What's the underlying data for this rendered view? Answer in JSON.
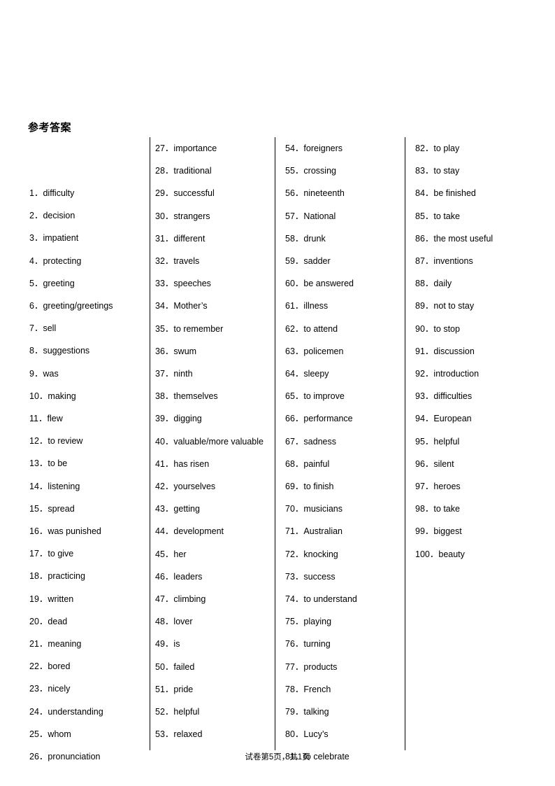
{
  "document": {
    "title": "参考答案",
    "page_size": "A4"
  },
  "columns": [
    {
      "id": "column-1",
      "items": [
        {
          "number": "1",
          "separator": "．",
          "answer": "difficulty"
        },
        {
          "number": "2",
          "separator": "．",
          "answer": "decision"
        },
        {
          "number": "3",
          "separator": "．",
          "answer": "impatient"
        },
        {
          "number": "4",
          "separator": "．",
          "answer": "protecting"
        },
        {
          "number": "5",
          "separator": "．",
          "answer": "greeting"
        },
        {
          "number": "6",
          "separator": "．",
          "answer": "greeting/greetings"
        },
        {
          "number": "7",
          "separator": "．",
          "answer": "sell"
        },
        {
          "number": "8",
          "separator": "．",
          "answer": "suggestions"
        },
        {
          "number": "9",
          "separator": "．",
          "answer": "was"
        },
        {
          "number": "10",
          "separator": "．",
          "answer": "making"
        },
        {
          "number": "11",
          "separator": "．",
          "answer": "flew"
        },
        {
          "number": "12",
          "separator": "．",
          "answer": "to review"
        },
        {
          "number": "13",
          "separator": "．",
          "answer": "to be"
        },
        {
          "number": "14",
          "separator": "．",
          "answer": "listening"
        },
        {
          "number": "15",
          "separator": "．",
          "answer": "spread"
        },
        {
          "number": "16",
          "separator": "．",
          "answer": "was punished"
        },
        {
          "number": "17",
          "separator": "．",
          "answer": "to give"
        },
        {
          "number": "18",
          "separator": "．",
          "answer": "practicing"
        },
        {
          "number": "19",
          "separator": "．",
          "answer": "written"
        },
        {
          "number": "20",
          "separator": "．",
          "answer": "dead"
        },
        {
          "number": "21",
          "separator": "．",
          "answer": "meaning"
        },
        {
          "number": "22",
          "separator": "．",
          "answer": "bored"
        },
        {
          "number": "23",
          "separator": "．",
          "answer": "nicely"
        },
        {
          "number": "24",
          "separator": "．",
          "answer": "understanding"
        },
        {
          "number": "25",
          "separator": "．",
          "answer": "whom"
        },
        {
          "number": "26",
          "separator": "．",
          "answer": "pronunciation"
        }
      ]
    },
    {
      "id": "column-2",
      "items": [
        {
          "number": "27",
          "separator": "．",
          "answer": "importance"
        },
        {
          "number": "28",
          "separator": "．",
          "answer": "traditional"
        },
        {
          "number": "29",
          "separator": "．",
          "answer": "successful"
        },
        {
          "number": "30",
          "separator": "．",
          "answer": "strangers"
        },
        {
          "number": "31",
          "separator": "．",
          "answer": "different"
        },
        {
          "number": "32",
          "separator": "．",
          "answer": "travels"
        },
        {
          "number": "33",
          "separator": "．",
          "answer": "speeches"
        },
        {
          "number": "34",
          "separator": "．",
          "answer": "Mother’s"
        },
        {
          "number": "35",
          "separator": "．",
          "answer": "to remember"
        },
        {
          "number": "36",
          "separator": "．",
          "answer": "swum"
        },
        {
          "number": "37",
          "separator": "．",
          "answer": "ninth"
        },
        {
          "number": "38",
          "separator": "．",
          "answer": "themselves"
        },
        {
          "number": "39",
          "separator": "．",
          "answer": "digging"
        },
        {
          "number": "40",
          "separator": "．",
          "answer": "valuable/more valuable"
        },
        {
          "number": "41",
          "separator": "．",
          "answer": "has risen"
        },
        {
          "number": "42",
          "separator": "．",
          "answer": "yourselves"
        },
        {
          "number": "43",
          "separator": "．",
          "answer": "getting"
        },
        {
          "number": "44",
          "separator": "．",
          "answer": "development"
        },
        {
          "number": "45",
          "separator": "．",
          "answer": "her"
        },
        {
          "number": "46",
          "separator": "．",
          "answer": "leaders"
        },
        {
          "number": "47",
          "separator": "．",
          "answer": "climbing"
        },
        {
          "number": "48",
          "separator": "．",
          "answer": "lover"
        },
        {
          "number": "49",
          "separator": "．",
          "answer": "is"
        },
        {
          "number": "50",
          "separator": "．",
          "answer": "failed"
        },
        {
          "number": "51",
          "separator": "．",
          "answer": "pride"
        },
        {
          "number": "52",
          "separator": "．",
          "answer": "helpful"
        },
        {
          "number": "53",
          "separator": "．",
          "answer": "relaxed"
        }
      ]
    },
    {
      "id": "column-3",
      "items": [
        {
          "number": "54",
          "separator": "．",
          "answer": "foreigners"
        },
        {
          "number": "55",
          "separator": "．",
          "answer": "crossing"
        },
        {
          "number": "56",
          "separator": "．",
          "answer": "nineteenth"
        },
        {
          "number": "57",
          "separator": "．",
          "answer": "National"
        },
        {
          "number": "58",
          "separator": "．",
          "answer": "drunk"
        },
        {
          "number": "59",
          "separator": "．",
          "answer": "sadder"
        },
        {
          "number": "60",
          "separator": "．",
          "answer": "be answered"
        },
        {
          "number": "61",
          "separator": "．",
          "answer": "illness"
        },
        {
          "number": "62",
          "separator": "．",
          "answer": "to attend"
        },
        {
          "number": "63",
          "separator": "．",
          "answer": "policemen"
        },
        {
          "number": "64",
          "separator": "．",
          "answer": "sleepy"
        },
        {
          "number": "65",
          "separator": "．",
          "answer": "to improve"
        },
        {
          "number": "66",
          "separator": "．",
          "answer": "performance"
        },
        {
          "number": "67",
          "separator": "．",
          "answer": "sadness"
        },
        {
          "number": "68",
          "separator": "．",
          "answer": "painful"
        },
        {
          "number": "69",
          "separator": "．",
          "answer": "to finish"
        },
        {
          "number": "70",
          "separator": "．",
          "answer": "musicians"
        },
        {
          "number": "71",
          "separator": "．",
          "answer": "Australian"
        },
        {
          "number": "72",
          "separator": "．",
          "answer": "knocking"
        },
        {
          "number": "73",
          "separator": "．",
          "answer": "success"
        },
        {
          "number": "74",
          "separator": "．",
          "answer": "to understand"
        },
        {
          "number": "75",
          "separator": "．",
          "answer": "playing"
        },
        {
          "number": "76",
          "separator": "．",
          "answer": "turning"
        },
        {
          "number": "77",
          "separator": "．",
          "answer": "products"
        },
        {
          "number": "78",
          "separator": "．",
          "answer": "French"
        },
        {
          "number": "79",
          "separator": "．",
          "answer": "talking"
        },
        {
          "number": "80",
          "separator": "．",
          "answer": "Lucy’s"
        },
        {
          "number": "81",
          "separator": "．",
          "answer": "to celebrate"
        }
      ]
    },
    {
      "id": "column-4",
      "items": [
        {
          "number": "82",
          "separator": "．",
          "answer": "to play"
        },
        {
          "number": "83",
          "separator": "．",
          "answer": "to stay"
        },
        {
          "number": "84",
          "separator": "．",
          "answer": "be finished"
        },
        {
          "number": "85",
          "separator": "．",
          "answer": "to take"
        },
        {
          "number": "86",
          "separator": "．",
          "answer": "the most useful"
        },
        {
          "number": "87",
          "separator": "．",
          "answer": "inventions"
        },
        {
          "number": "88",
          "separator": "．",
          "answer": "daily"
        },
        {
          "number": "89",
          "separator": "．",
          "answer": "not to stay"
        },
        {
          "number": "90",
          "separator": "．",
          "answer": "to stop"
        },
        {
          "number": "91",
          "separator": "．",
          "answer": "discussion"
        },
        {
          "number": "92",
          "separator": "．",
          "answer": "introduction"
        },
        {
          "number": "93",
          "separator": "．",
          "answer": "difficulties"
        },
        {
          "number": "94",
          "separator": "．",
          "answer": "European"
        },
        {
          "number": "95",
          "separator": "．",
          "answer": "helpful"
        },
        {
          "number": "96",
          "separator": "．",
          "answer": "silent"
        },
        {
          "number": "97",
          "separator": "．",
          "answer": "heroes"
        },
        {
          "number": "98",
          "separator": "．",
          "answer": "to take"
        },
        {
          "number": "99",
          "separator": "．",
          "answer": "biggest"
        },
        {
          "number": "100",
          "separator": "．",
          "answer": "beauty"
        }
      ]
    }
  ],
  "footer": {
    "prefix": "试卷第",
    "current_page": "5",
    "middle": "页，共",
    "total_pages": "1",
    "suffix": "页"
  }
}
